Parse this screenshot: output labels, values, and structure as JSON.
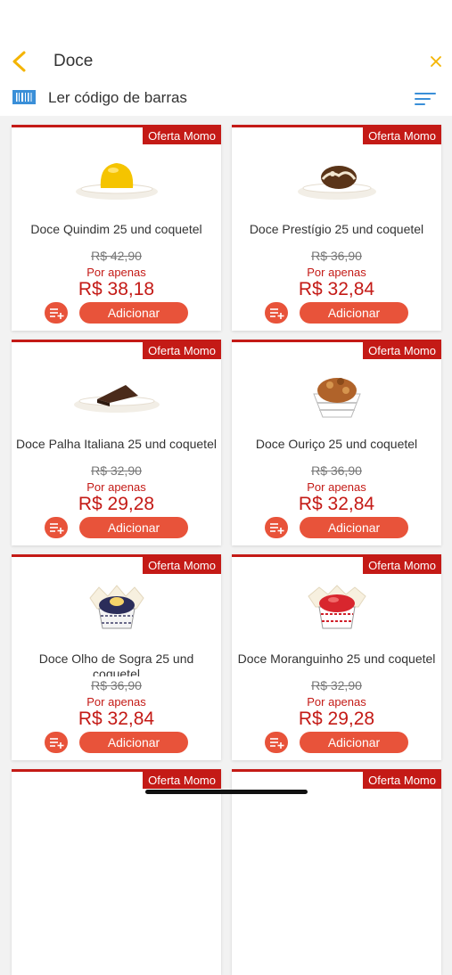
{
  "header": {
    "search_value": "Doce",
    "barcode_label": "Ler código de barras"
  },
  "colors": {
    "accent_yellow": "#f4b400",
    "brand_red": "#c41a16",
    "button_orange": "#e8533a",
    "barcode_blue": "#3a8fd8"
  },
  "products": [
    {
      "badge": "Oferta Momo",
      "name": "Doce Quindim 25 und coquetel",
      "old_price": "R$ 42,90",
      "promo_label": "Por apenas",
      "price": "R$ 38,18",
      "add_label": "Adicionar",
      "image": "quindim"
    },
    {
      "badge": "Oferta Momo",
      "name": "Doce Prestígio 25 und coquetel",
      "old_price": "R$ 36,90",
      "promo_label": "Por apenas",
      "price": "R$ 32,84",
      "add_label": "Adicionar",
      "image": "prestigio"
    },
    {
      "badge": "Oferta Momo",
      "name": "Doce Palha Italiana 25 und coquetel",
      "old_price": "R$ 32,90",
      "promo_label": "Por apenas",
      "price": "R$ 29,28",
      "add_label": "Adicionar",
      "image": "palha-italiana"
    },
    {
      "badge": "Oferta Momo",
      "name": "Doce Ouriço 25 und coquetel",
      "old_price": "R$ 36,90",
      "promo_label": "Por apenas",
      "price": "R$ 32,84",
      "add_label": "Adicionar",
      "image": "ourico"
    },
    {
      "badge": "Oferta Momo",
      "name": "Doce Olho de Sogra 25 und coquetel",
      "old_price": "R$ 36,90",
      "promo_label": "Por apenas",
      "price": "R$ 32,84",
      "add_label": "Adicionar",
      "image": "olho-de-sogra"
    },
    {
      "badge": "Oferta Momo",
      "name": "Doce Moranguinho 25 und coquetel",
      "old_price": "R$ 32,90",
      "promo_label": "Por apenas",
      "price": "R$ 29,28",
      "add_label": "Adicionar",
      "image": "moranguinho"
    },
    {
      "badge": "Oferta Momo",
      "name": "",
      "old_price": "",
      "promo_label": "",
      "price": "",
      "add_label": "",
      "image": ""
    },
    {
      "badge": "Oferta Momo",
      "name": "",
      "old_price": "",
      "promo_label": "",
      "price": "",
      "add_label": "",
      "image": ""
    }
  ]
}
